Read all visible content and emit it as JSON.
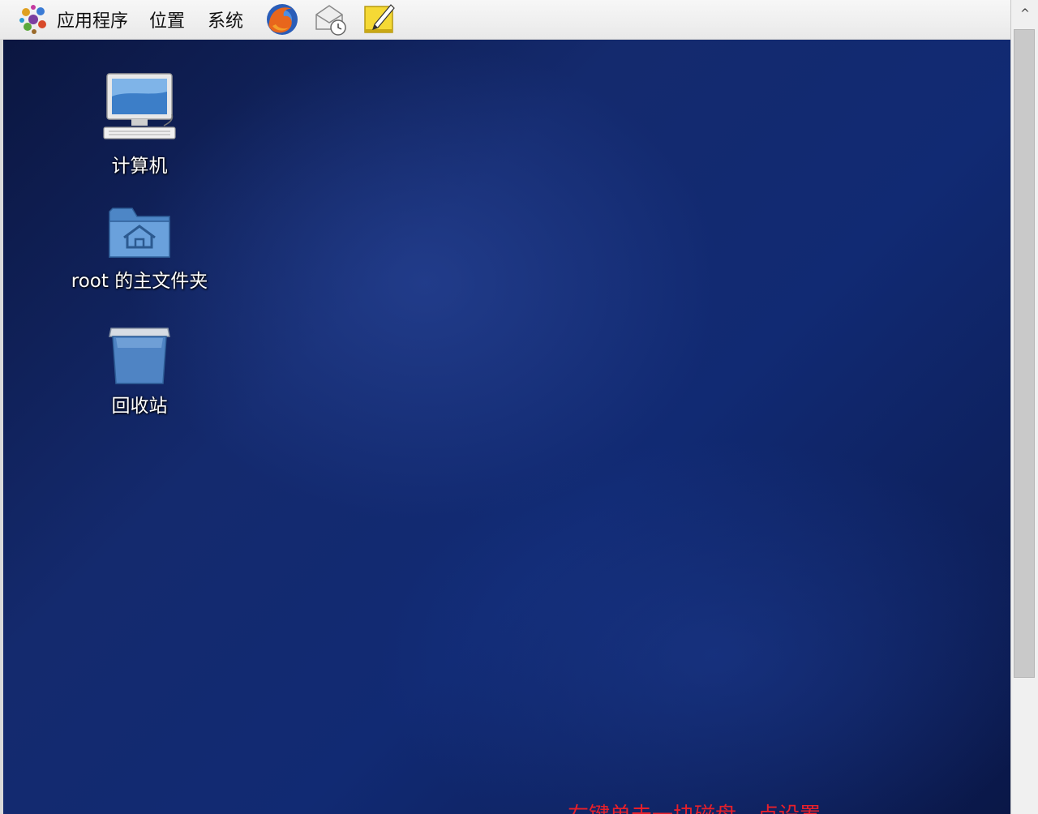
{
  "panel": {
    "menus": {
      "applications": "应用程序",
      "places": "位置",
      "system": "系统"
    },
    "launchers": [
      "firefox-icon",
      "mail-clock-icon",
      "notes-icon"
    ]
  },
  "desktop": {
    "icons": [
      {
        "label": "计算机",
        "icon": "computer-icon"
      },
      {
        "label": "root 的主文件夹",
        "icon": "home-folder-icon"
      },
      {
        "label": "回收站",
        "icon": "trash-icon"
      }
    ],
    "hint": "右键单击一块磁盘，点设置",
    "hint_color": "#e8202a"
  },
  "scrollbar": {
    "up_arrow": "^"
  }
}
